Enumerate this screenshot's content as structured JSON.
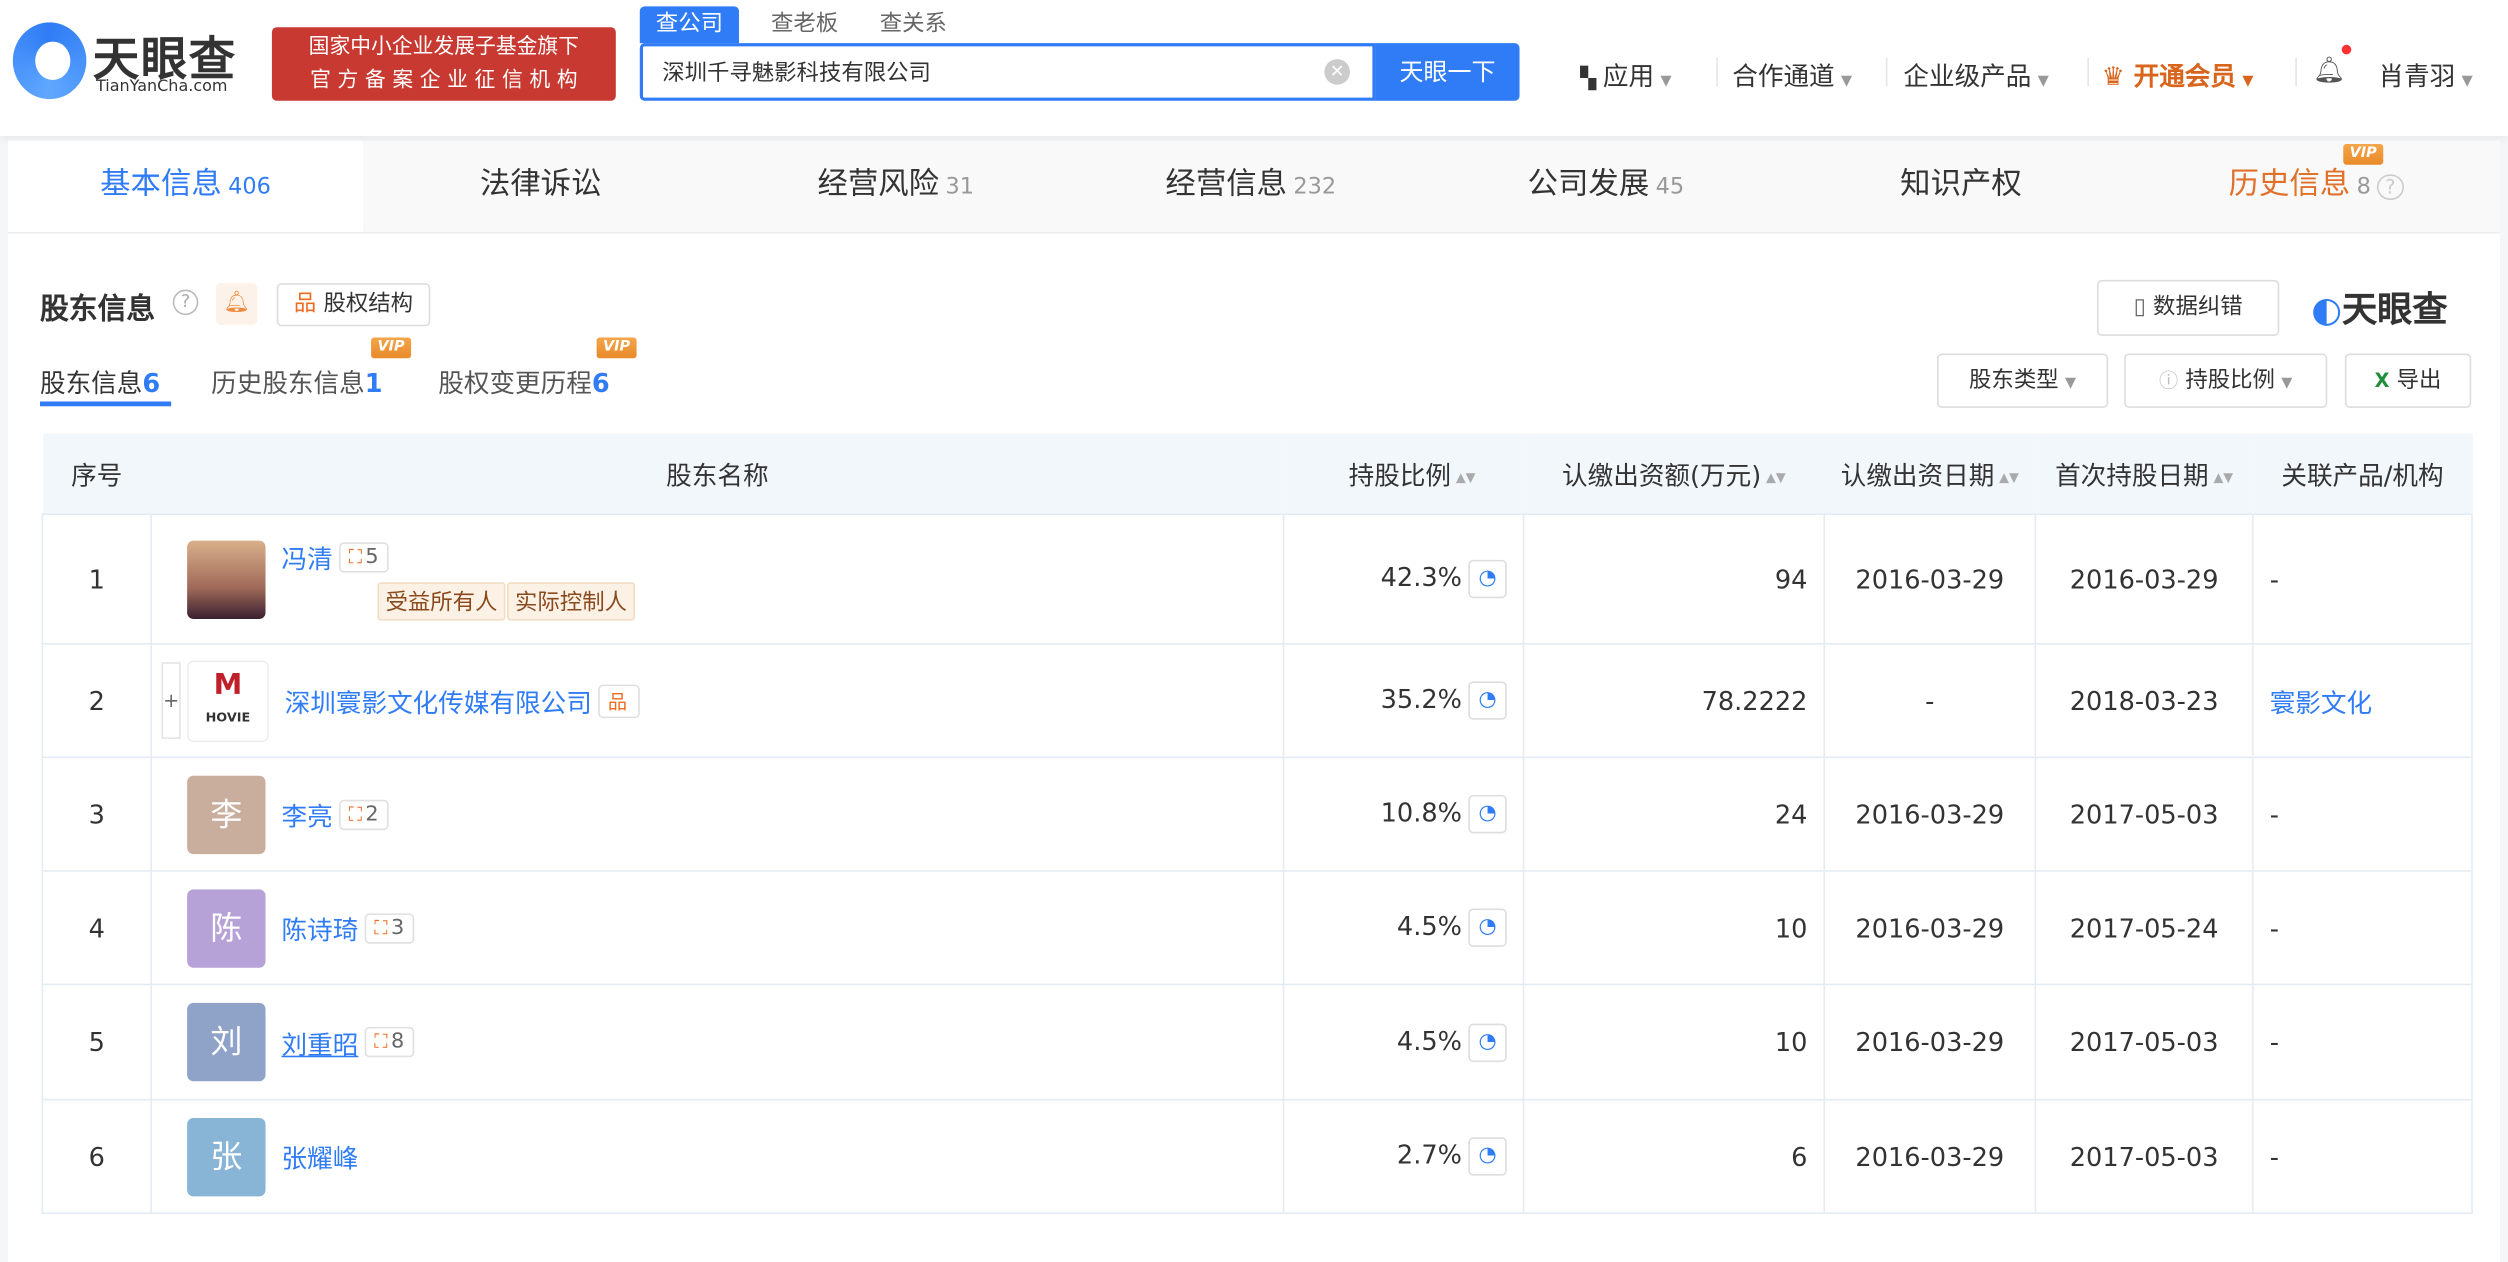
{
  "header": {
    "logo_text": "天眼查",
    "logo_sub": "TianYanCha.com",
    "badge_line1": "国家中小企业发展子基金旗下",
    "badge_line2": "官 方 备 案 企 业 征 信 机 构",
    "search_tabs": [
      "查公司",
      "查老板",
      "查关系"
    ],
    "search_value": "深圳千寻魅影科技有限公司",
    "search_button": "天眼一下",
    "nav": [
      "应用",
      "合作通道",
      "企业级产品",
      "开通会员",
      "肖青羽"
    ]
  },
  "tabs": [
    {
      "label": "基本信息",
      "count": "406"
    },
    {
      "label": "法律诉讼",
      "count": ""
    },
    {
      "label": "经营风险",
      "count": "31"
    },
    {
      "label": "经营信息",
      "count": "232"
    },
    {
      "label": "公司发展",
      "count": "45"
    },
    {
      "label": "知识产权",
      "count": ""
    },
    {
      "label": "历史信息",
      "count": "8"
    }
  ],
  "vip_label": "VIP",
  "section": {
    "title": "股东信息",
    "structure_button": "股权结构",
    "correct_button": "数据纠错",
    "brand": "天眼查",
    "subtabs": [
      {
        "label": "股东信息",
        "count": "6"
      },
      {
        "label": "历史股东信息",
        "count": "1"
      },
      {
        "label": "股权变更历程",
        "count": "6"
      }
    ],
    "filters": [
      "股东类型",
      "持股比例",
      "导出"
    ]
  },
  "table": {
    "headers": [
      "序号",
      "股东名称",
      "持股比例",
      "认缴出资额(万元)",
      "认缴出资日期",
      "首次持股日期",
      "关联产品/机构"
    ],
    "rows": [
      {
        "no": "1",
        "avatar": "",
        "name": "冯清",
        "rel": "5",
        "tags": [
          "受益所有人",
          "实际控制人"
        ],
        "ratio": "42.3%",
        "amount": "94",
        "date1": "2016-03-29",
        "date2": "2016-03-29",
        "product": "-"
      },
      {
        "no": "2",
        "avatar": "HOVIE",
        "name": "深圳寰影文化传媒有限公司",
        "rel": "",
        "tags": [],
        "ratio": "35.2%",
        "amount": "78.2222",
        "date1": "-",
        "date2": "2018-03-23",
        "product": "寰影文化"
      },
      {
        "no": "3",
        "avatar": "李",
        "name": "李亮",
        "rel": "2",
        "tags": [],
        "ratio": "10.8%",
        "amount": "24",
        "date1": "2016-03-29",
        "date2": "2017-05-03",
        "product": "-",
        "color": "#c9ae9d"
      },
      {
        "no": "4",
        "avatar": "陈",
        "name": "陈诗琦",
        "rel": "3",
        "tags": [],
        "ratio": "4.5%",
        "amount": "10",
        "date1": "2016-03-29",
        "date2": "2017-05-24",
        "product": "-",
        "color": "#b7a2d8"
      },
      {
        "no": "5",
        "avatar": "刘",
        "name": "刘重昭",
        "rel": "8",
        "tags": [],
        "ratio": "4.5%",
        "amount": "10",
        "date1": "2016-03-29",
        "date2": "2017-05-03",
        "product": "-",
        "color": "#8fa3c9"
      },
      {
        "no": "6",
        "avatar": "张",
        "name": "张耀峰",
        "rel": "",
        "tags": [],
        "ratio": "2.7%",
        "amount": "6",
        "date1": "2016-03-29",
        "date2": "2017-05-03",
        "product": "-",
        "color": "#88b4d6"
      }
    ]
  }
}
